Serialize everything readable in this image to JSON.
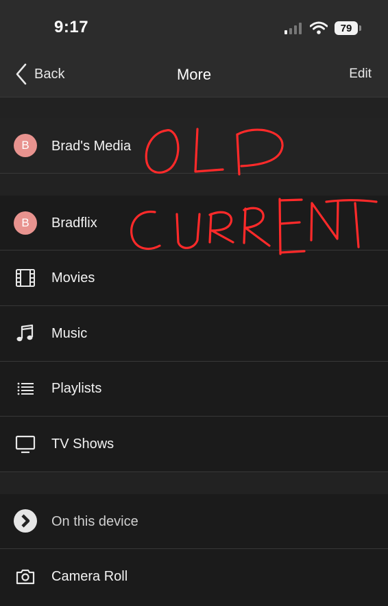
{
  "status": {
    "time": "9:17",
    "battery": "79"
  },
  "nav": {
    "back_label": "Back",
    "title": "More",
    "edit_label": "Edit"
  },
  "items": [
    {
      "label": "Brad's Media",
      "avatar_letter": "B",
      "icon": "avatar"
    },
    {
      "label": "Bradflix",
      "avatar_letter": "B",
      "icon": "avatar"
    },
    {
      "label": "Movies",
      "icon": "film-icon"
    },
    {
      "label": "Music",
      "icon": "music-note-icon"
    },
    {
      "label": "Playlists",
      "icon": "list-icon"
    },
    {
      "label": "TV Shows",
      "icon": "tv-icon"
    },
    {
      "label": "On this device",
      "icon": "plex-chevron-icon"
    },
    {
      "label": "Camera Roll",
      "icon": "camera-icon"
    }
  ],
  "annotations": {
    "old": "OLD",
    "current": "CURRENT",
    "color": "#ff2a2a"
  },
  "colors": {
    "avatar": "#e8938f",
    "background": "#1b1b1b",
    "header": "#2c2c2c"
  }
}
